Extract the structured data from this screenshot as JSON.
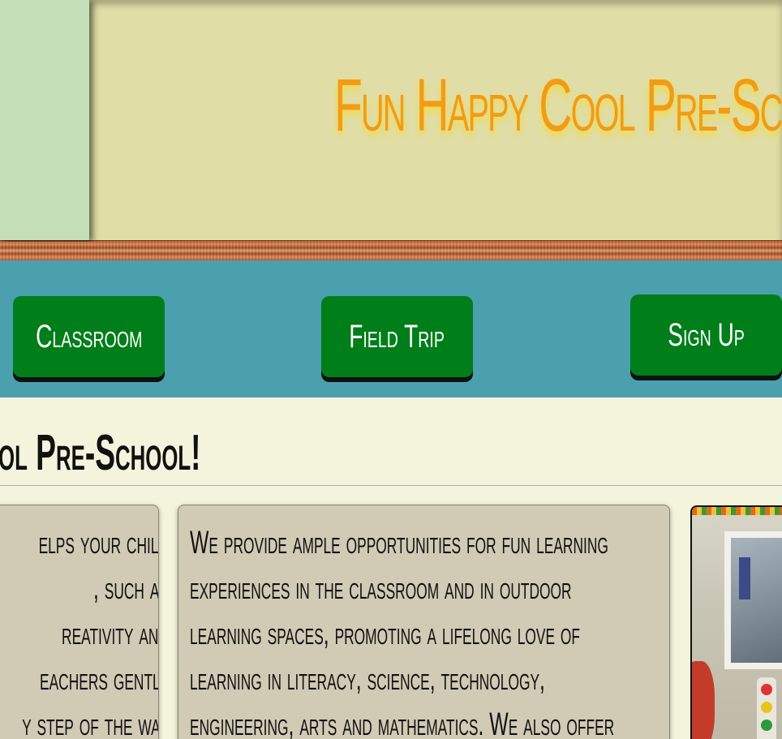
{
  "header": {
    "title": "Fun Happy Cool Pre-School"
  },
  "nav": {
    "classroom_label": "Classroom",
    "fieldtrip_label": "Field Trip",
    "signup_label": "Sign Up"
  },
  "main": {
    "welcome_heading": "ol Pre-School!",
    "left_card_lines": [
      "elps your child",
      ", such as",
      "reativity and",
      "eachers gently",
      "y step of the way"
    ],
    "mid_card_lines": [
      "We provide ample opportunities for fun learning",
      "experiences in the classroom and in outdoor",
      "learning spaces, promoting a lifelong love of",
      "learning in literacy, science, technology,",
      "engineering, arts and mathematics. We also offer"
    ]
  },
  "colors": {
    "header_bg": "#e0dea6",
    "logo_panel_bg": "#c4dfb8",
    "title_color": "#f39c12",
    "nav_bg": "#4aa0ad",
    "button_bg": "#007e1a",
    "card_bg": "#d1cab4",
    "page_bg": "#f4f4dc"
  }
}
